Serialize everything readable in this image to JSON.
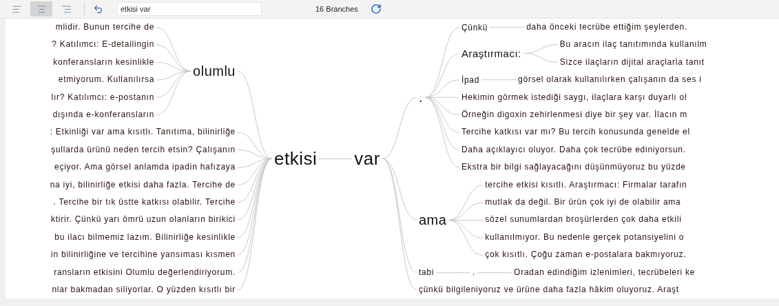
{
  "toolbar": {
    "align_buttons": [
      {
        "kind": "left",
        "selected": false
      },
      {
        "kind": "center",
        "selected": true
      },
      {
        "kind": "right",
        "selected": false
      }
    ],
    "search": {
      "value": "etkisi var"
    },
    "branch_count": "16 Branches"
  },
  "word_tree": {
    "root": {
      "left": "etkisi",
      "right": "var"
    },
    "left_branches": [
      {
        "text": "olumlu",
        "children": [
          {
            "text": "mlidir. Bunun tercihe de"
          },
          {
            "text": "? Katılımcı: E-detailingin"
          },
          {
            "text": "konferansların kesinlikle"
          },
          {
            "text": "etmiyorum. Kullanılırsa"
          },
          {
            "text": "lır? Katılımcı: e-postanın"
          },
          {
            "text": "dışında e-konferansların"
          }
        ]
      },
      {
        "text": ": Etkinliği var ama kısıtlı. Tanıtıma, bilinirliğe"
      },
      {
        "text": "şullarda ürünü neden tercih etsin? Çalışanın"
      },
      {
        "text": "eçiyor. Ama görsel anlamda ipadin hafızaya"
      },
      {
        "text": "na iyi, bilinirliğe etkisi daha fazla. Tercihe de"
      },
      {
        "text": ". Tercihe bir tık üstte katkısı olabilir. Tercihe"
      },
      {
        "text": "ktirir. Çünkü yarı ömrü uzun olanların birikici"
      },
      {
        "text": "bu ilacı bilmemiz lazım. Bilinirliğe kesinlikle"
      },
      {
        "text": "in bilinirliğine ve tercihine yansıması kısmen"
      },
      {
        "text": "ransların etkisini Olumlu değerlendiriyorum."
      },
      {
        "text": "nlar bakmadan siliyorlar. O yüzden kısıtlı bir"
      }
    ],
    "right_branches": [
      {
        "text": ".",
        "children": [
          {
            "text": "Çünkü",
            "children": [
              {
                "text": "daha önceki tecrübe ettiğim şeylerden."
              }
            ]
          },
          {
            "text": "Araştırmacı:",
            "children": [
              {
                "text": "Bu aracın ilaç tanıtımında kullanılm"
              },
              {
                "text": "Sizce ilaçların dijital araçlarla tanıt"
              }
            ]
          },
          {
            "text": "İpad",
            "children": [
              {
                "text": "görsel olarak kullanılırken çalışanın da ses i"
              }
            ]
          },
          {
            "text": "Hekimin görmek istediği saygı, ilaçlara karşı duyarlı ol"
          },
          {
            "text": "Örneğin digoxin zehirlenmesi diye bir şey var. İlacın m"
          },
          {
            "text": "Tercihe katkısı var mı? Bu tercih konusunda genelde el"
          },
          {
            "text": "Daha açıklayıcı oluyor. Daha çok tecrübe ediniyorsun."
          },
          {
            "text": "Ekstra bir bilgi sağlayacağını düşünmüyoruz bu yüzde"
          }
        ]
      },
      {
        "text": "ama",
        "children": [
          {
            "text": "tercihe etkisi kısıtlı. Araştırmacı: Firmalar tarafın"
          },
          {
            "text": "mutlak da değil. Bir ürün çok iyi de olabilir ama"
          },
          {
            "text": "sözel sunumlardan broşürlerden çok daha etkili"
          },
          {
            "text": "kullanılmıyor. Bu nedenle gerçek potansiyelini o"
          },
          {
            "text": "çok kısıtlı. Çoğu zaman e-postalara bakmıyoruz."
          }
        ]
      },
      {
        "text": "tabi",
        "children": [
          {
            "text": ".",
            "children": [
              {
                "text": "Oradan edindiğim izlenimleri, tecrübeleri ke"
              }
            ]
          }
        ]
      },
      {
        "text": "çünkü bilgileniyoruz ve ürüne daha fazla hâkim oluyoruz. Araşt"
      }
    ]
  }
}
